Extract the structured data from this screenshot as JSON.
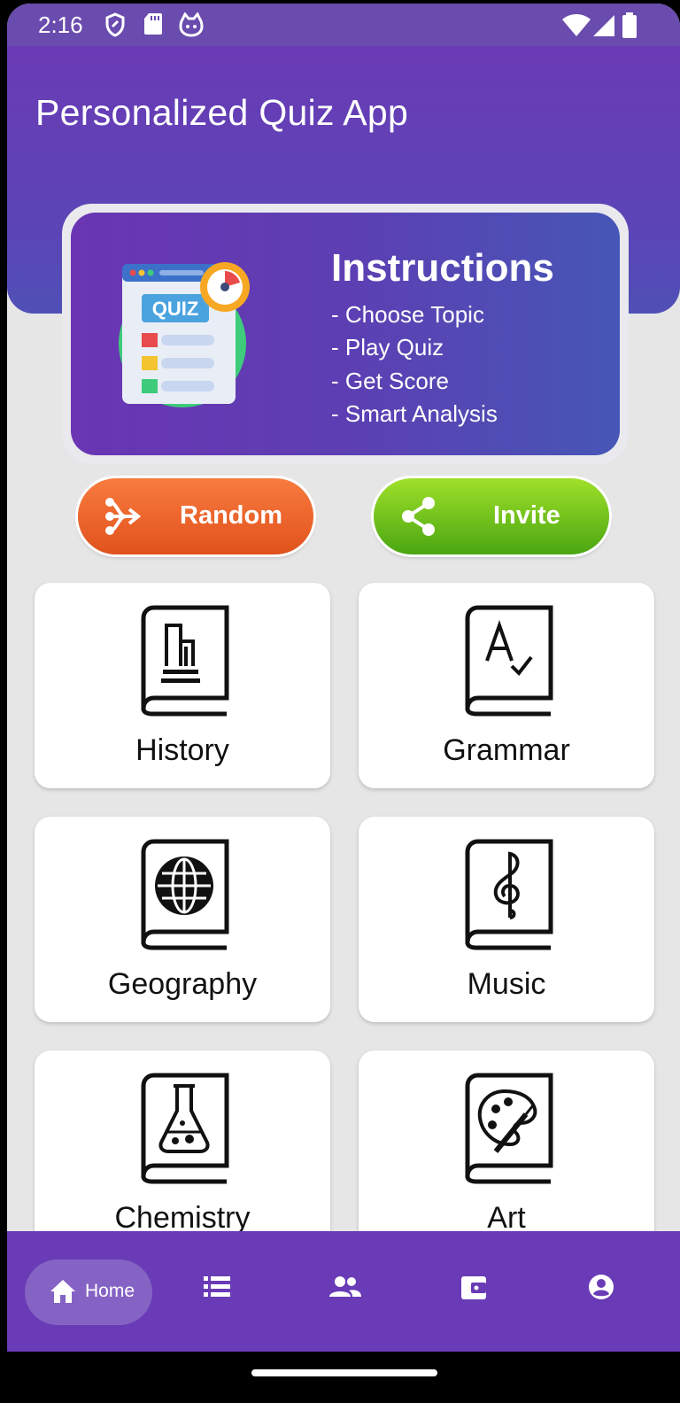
{
  "status_bar": {
    "time": "2:16",
    "icons": [
      "shield-icon",
      "sd-card-icon",
      "cat-icon",
      "wifi-icon",
      "signal-icon",
      "battery-icon"
    ],
    "background": "#6a4bae"
  },
  "header": {
    "title": "Personalized Quiz App"
  },
  "instructions": {
    "title": "Instructions",
    "items": [
      "- Choose Topic",
      "- Play Quiz",
      "- Get Score",
      "- Smart Analysis"
    ],
    "illustration_text": "QUIZ"
  },
  "actions": {
    "random": {
      "label": "Random",
      "icon": "split-arrow-icon",
      "color": "#e95a22"
    },
    "invite": {
      "label": "Invite",
      "icon": "share-icon",
      "color": "#5bb315"
    }
  },
  "topics": [
    {
      "label": "History",
      "icon": "history-book-icon"
    },
    {
      "label": "Grammar",
      "icon": "grammar-book-icon"
    },
    {
      "label": "Geography",
      "icon": "geography-book-icon"
    },
    {
      "label": "Music",
      "icon": "music-book-icon"
    },
    {
      "label": "Chemistry",
      "icon": "chemistry-book-icon"
    },
    {
      "label": "Art",
      "icon": "art-book-icon"
    }
  ],
  "bottom_nav": {
    "items": [
      {
        "label": "Home",
        "icon": "home-icon",
        "active": true
      },
      {
        "icon": "list-icon"
      },
      {
        "icon": "people-icon"
      },
      {
        "icon": "wallet-icon"
      },
      {
        "icon": "account-icon"
      }
    ],
    "background": "#6a3bb6"
  }
}
